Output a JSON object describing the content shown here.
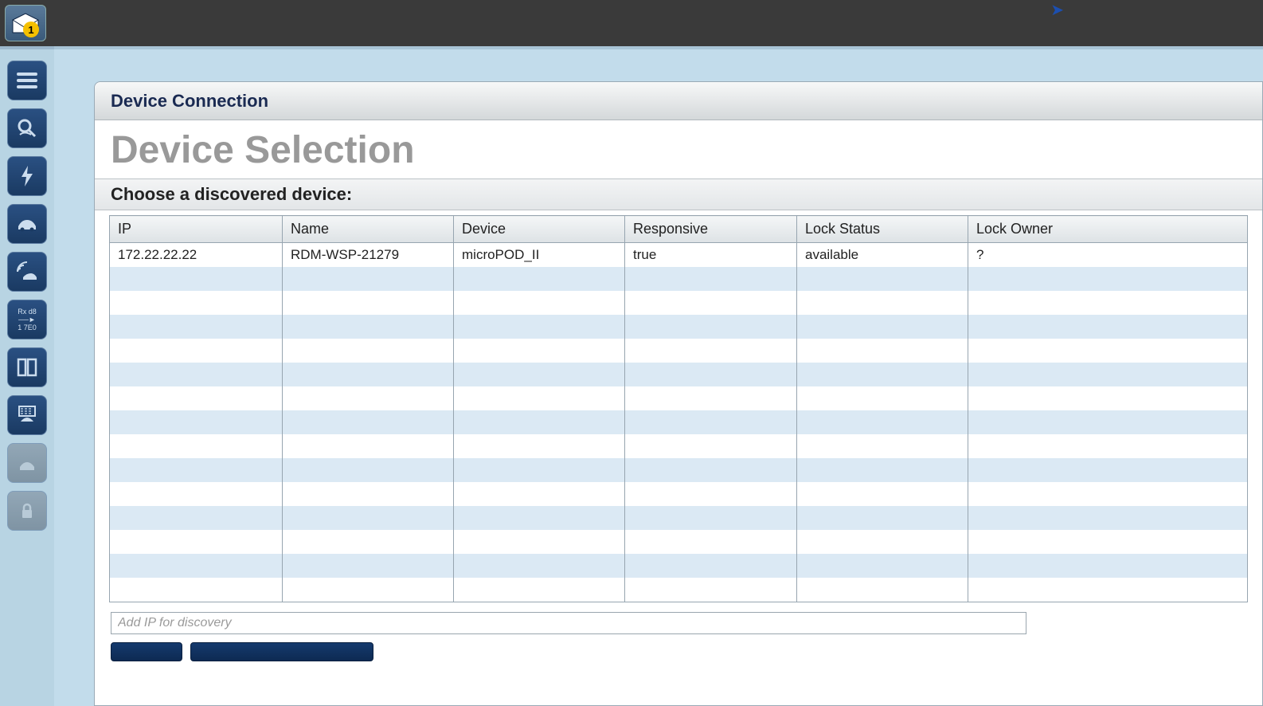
{
  "topbar": {
    "badge_count": "1"
  },
  "panel": {
    "header_title": "Device Connection",
    "page_title": "Device Selection",
    "subhead": "Choose a discovered device:"
  },
  "table": {
    "columns": [
      "IP",
      "Name",
      "Device",
      "Responsive",
      "Lock Status",
      "Lock Owner"
    ],
    "rows": [
      {
        "ip": "172.22.22.22",
        "name": "RDM-WSP-21279",
        "device": "microPOD_II",
        "responsive": "true",
        "lock_status": "available",
        "lock_owner": "?"
      }
    ],
    "empty_row_count": 14
  },
  "ip_input": {
    "placeholder": "Add IP for discovery"
  },
  "sidebar_buttons": [
    "menu-icon",
    "scan-vehicle-icon",
    "flash-icon",
    "vehicle-icon",
    "wifi-vehicle-icon",
    "address-icon",
    "layout-icon",
    "vehicle-data-icon",
    "vehicle-config-icon",
    "lock-icon"
  ]
}
